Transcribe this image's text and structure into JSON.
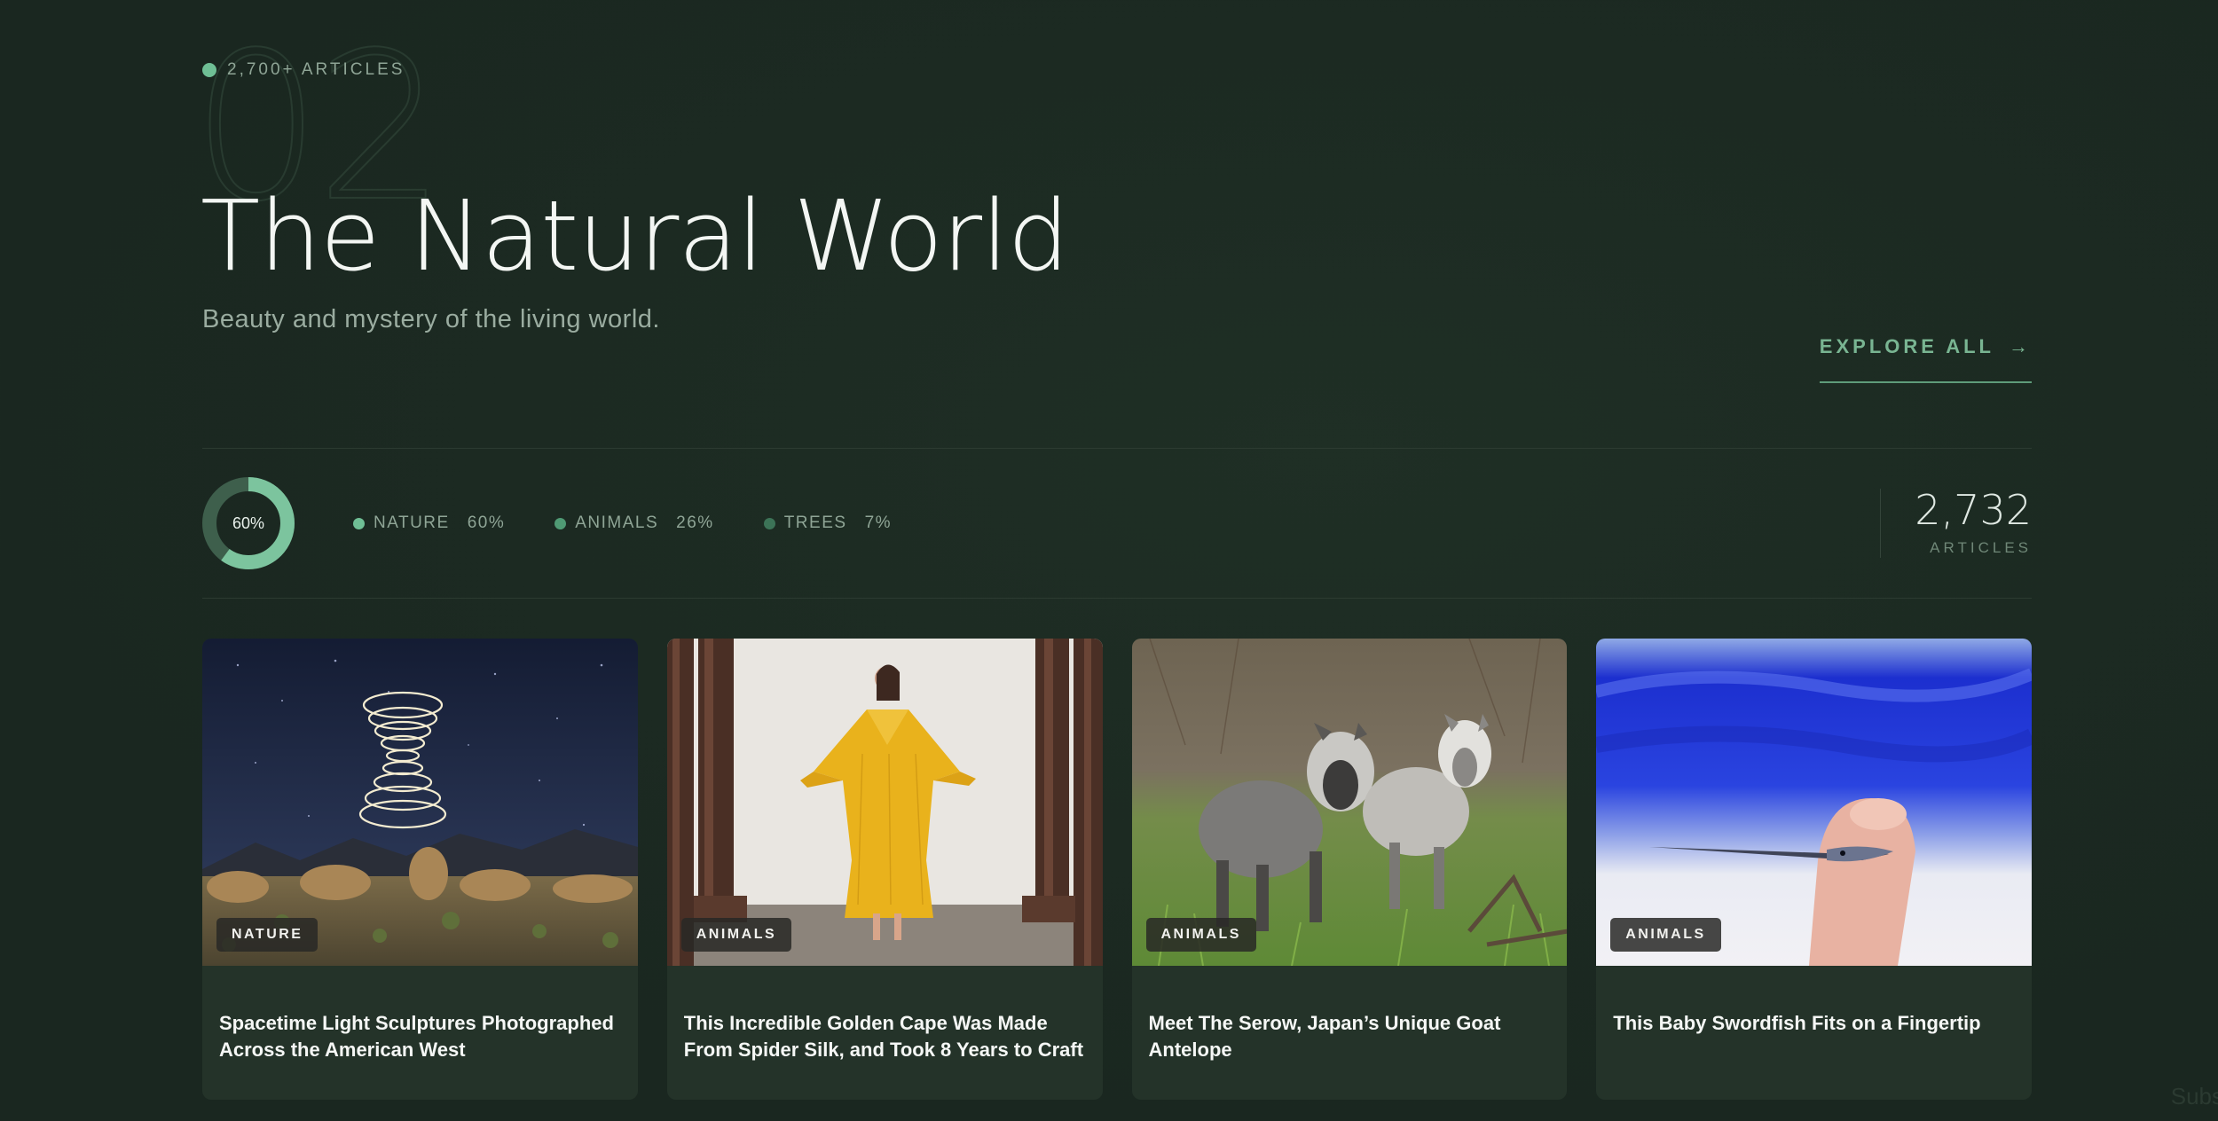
{
  "section": {
    "eyebrow": "2,700+ ARTICLES",
    "number": "02",
    "title": "The Natural World",
    "subtitle": "Beauty and mystery of the living world.",
    "explore_label": "EXPLORE ALL",
    "explore_arrow": "→"
  },
  "stats": {
    "donut_label": "60%",
    "donut_fraction": 0.6,
    "legend": [
      {
        "name": "NATURE",
        "value": "60%",
        "color": "#6fbf95"
      },
      {
        "name": "ANIMALS",
        "value": "26%",
        "color": "#4f9a74"
      },
      {
        "name": "TREES",
        "value": "7%",
        "color": "#3c7357"
      }
    ],
    "total_count": "2,732",
    "total_label": "ARTICLES"
  },
  "cards": [
    {
      "tag": "NATURE",
      "title": "Spacetime Light Sculptures Photographed Across the American West",
      "image": "desert-night-light-sculpture"
    },
    {
      "tag": "ANIMALS",
      "title": "This Incredible Golden Cape Was Made From Spider Silk, and Took 8 Years to Craft",
      "image": "golden-cape-model"
    },
    {
      "tag": "ANIMALS",
      "title": "Meet The Serow, Japan’s Unique Goat Antelope",
      "image": "serow-pair-grass"
    },
    {
      "tag": "ANIMALS",
      "title": "This Baby Swordfish Fits on a Fingertip",
      "image": "baby-swordfish-fingertip"
    }
  ],
  "footer_hint": "Subs"
}
